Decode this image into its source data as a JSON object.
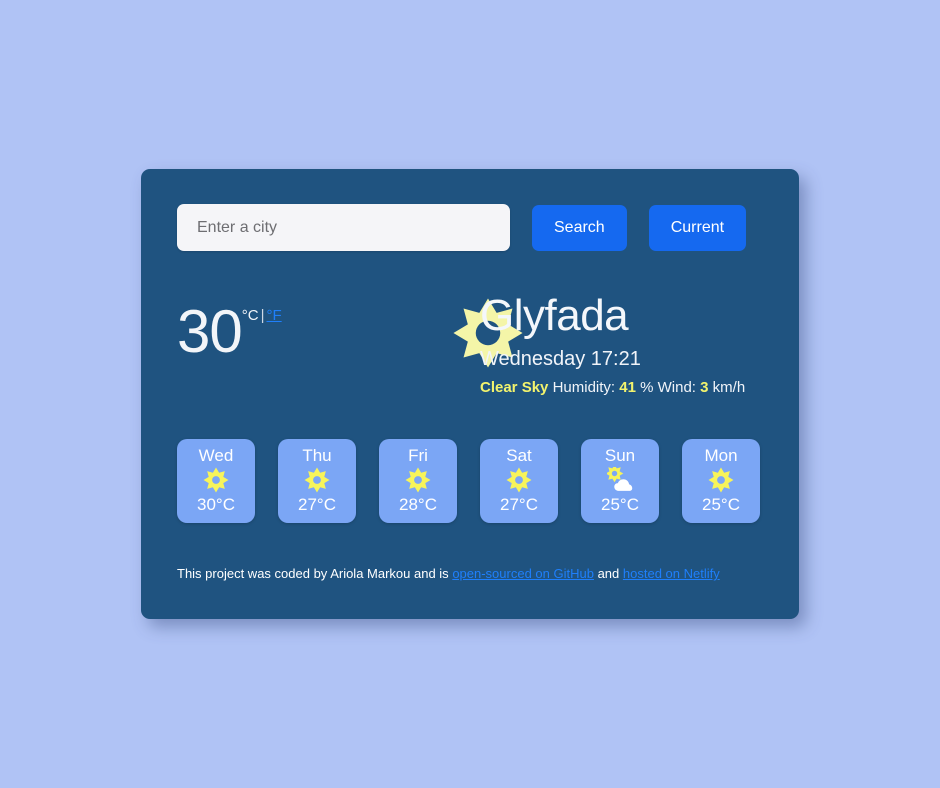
{
  "colors": {
    "page_background": "#b0c3f5",
    "card_background": "#1f5380",
    "button_blue": "#1569f0",
    "forecast_card_blue": "#7ba6f5",
    "accent_yellow": "#f2f36d",
    "link_blue": "#1f7ffb",
    "input_background": "#f5f5f8"
  },
  "search": {
    "placeholder": "Enter a city",
    "value": "",
    "search_label": "Search",
    "current_label": "Current"
  },
  "current": {
    "temperature": "30",
    "unit_celsius": "°C",
    "unit_separator": "|",
    "unit_fahrenheit": "°F",
    "icon": "sun-icon",
    "city": "Glyfada",
    "day_time": "Wednesday 17:21",
    "description": "Clear Sky",
    "humidity_label": "Humidity:",
    "humidity_value": "41",
    "humidity_unit": "%",
    "wind_label": "Wind:",
    "wind_value": "3",
    "wind_unit": "km/h"
  },
  "forecast": [
    {
      "day": "Wed",
      "icon": "sun-icon",
      "temp": "30°C"
    },
    {
      "day": "Thu",
      "icon": "sun-icon",
      "temp": "27°C"
    },
    {
      "day": "Fri",
      "icon": "sun-icon",
      "temp": "28°C"
    },
    {
      "day": "Sat",
      "icon": "sun-icon",
      "temp": "27°C"
    },
    {
      "day": "Sun",
      "icon": "sun-cloud-icon",
      "temp": "25°C"
    },
    {
      "day": "Mon",
      "icon": "sun-icon",
      "temp": "25°C"
    }
  ],
  "footer": {
    "text_before": "This project was coded by Ariola Markou and is ",
    "link_github": "open-sourced on GitHub",
    "text_middle": " and ",
    "link_netlify": "hosted on Netlify"
  }
}
